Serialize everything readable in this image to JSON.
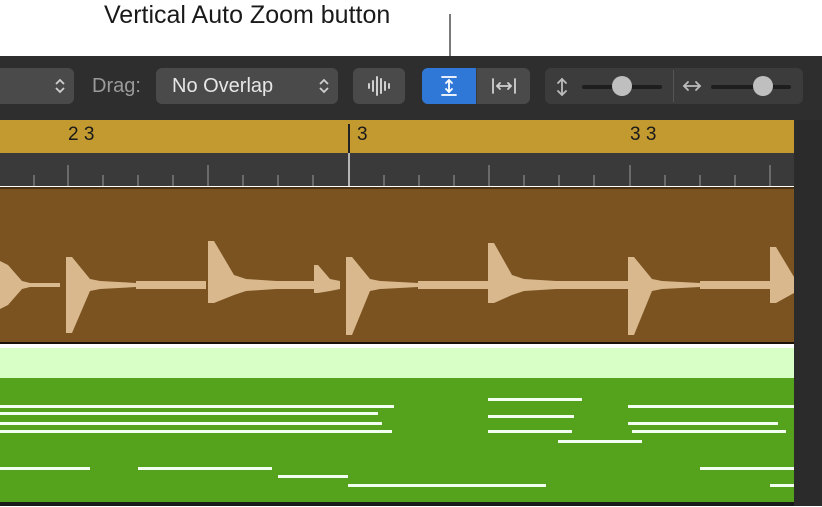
{
  "callout": {
    "text": "Vertical Auto Zoom button"
  },
  "toolbar": {
    "snap_dropdown_chevron": "⌃⌄",
    "drag_label": "Drag:",
    "drag_value": "No Overlap",
    "vertical_zoom_slider_value": 0.5,
    "horizontal_zoom_slider_value": 0.7
  },
  "ruler": {
    "bars": [
      "2 3",
      "3",
      "3 3"
    ]
  },
  "colors": {
    "toolbar_bg": "#2e2e2e",
    "active_blue": "#2f78d8",
    "ruler_gold": "#c29a30",
    "audio_region": "#7b5320",
    "waveform": "#d9b88e",
    "midi_header": "#d8ffc6",
    "midi_body": "#55a31d",
    "midi_note": "#f2fff0"
  }
}
